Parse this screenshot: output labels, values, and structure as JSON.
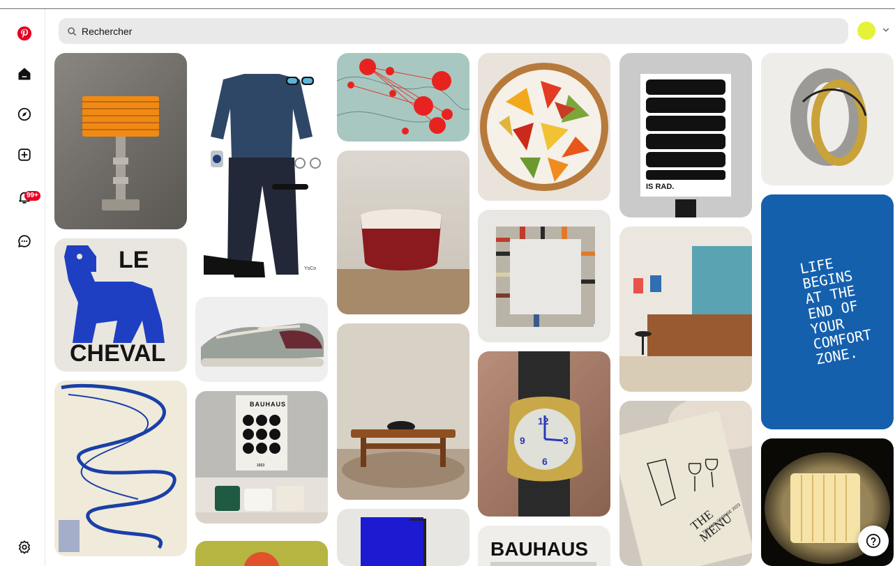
{
  "search": {
    "placeholder": "Rechercher"
  },
  "notifications": {
    "badge": "99+"
  },
  "pins": {
    "lamp": "",
    "outfit": {
      "signature": "YsCo"
    },
    "le_cheval": {
      "line1": "LE",
      "line2": "CHEVAL"
    },
    "sneakers": "",
    "bauhaus_poster": {
      "title": "BAUHAUS",
      "year": "1923"
    },
    "is_rad": {
      "caption": "IS RAD."
    },
    "life_quote": {
      "l1": "LIFE",
      "l2": "BEGINS",
      "l3": "AT THE",
      "l4": "END OF",
      "l5": "YOUR",
      "l6": "COMFORT",
      "l7": "ZONE."
    },
    "menu_card": {
      "title": "THE MENU",
      "subtitle": "TIM AND GEORGE 2023"
    },
    "bauhaus_book": {
      "title": "BAUHAUS"
    },
    "watch": {
      "n12": "12",
      "n3": "3",
      "n6": "6",
      "n9": "9"
    }
  },
  "colors": {
    "brand": "#e60023",
    "avatar": "#e6f13a",
    "cheval_blue": "#1f3fc2",
    "life_blue": "#1560ad"
  }
}
